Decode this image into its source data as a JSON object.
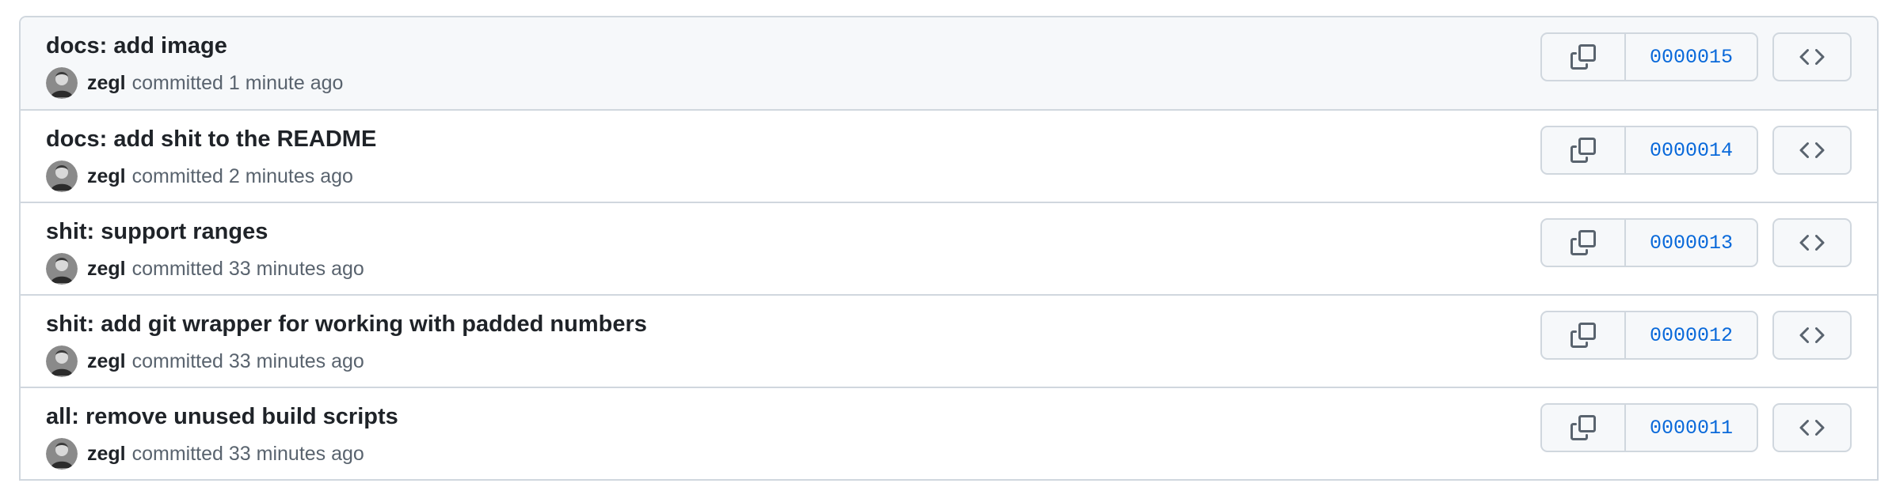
{
  "commits": [
    {
      "title": "docs: add image",
      "author": "zegl",
      "action": "committed",
      "time": "1 minute ago",
      "sha": "0000015"
    },
    {
      "title": "docs: add shit to the README",
      "author": "zegl",
      "action": "committed",
      "time": "2 minutes ago",
      "sha": "0000014"
    },
    {
      "title": "shit: support ranges",
      "author": "zegl",
      "action": "committed",
      "time": "33 minutes ago",
      "sha": "0000013"
    },
    {
      "title": "shit: add git wrapper for working with padded numbers",
      "author": "zegl",
      "action": "committed",
      "time": "33 minutes ago",
      "sha": "0000012"
    },
    {
      "title": "all: remove unused build scripts",
      "author": "zegl",
      "action": "committed",
      "time": "33 minutes ago",
      "sha": "0000011"
    }
  ],
  "icons": {
    "copy": "copy-icon",
    "browse": "code-icon",
    "avatar": "avatar"
  },
  "colors": {
    "sha_link": "#0969da",
    "border": "#d0d7de",
    "row_highlight": "#f6f8fa",
    "title": "#1f2328",
    "muted": "#59636e"
  }
}
